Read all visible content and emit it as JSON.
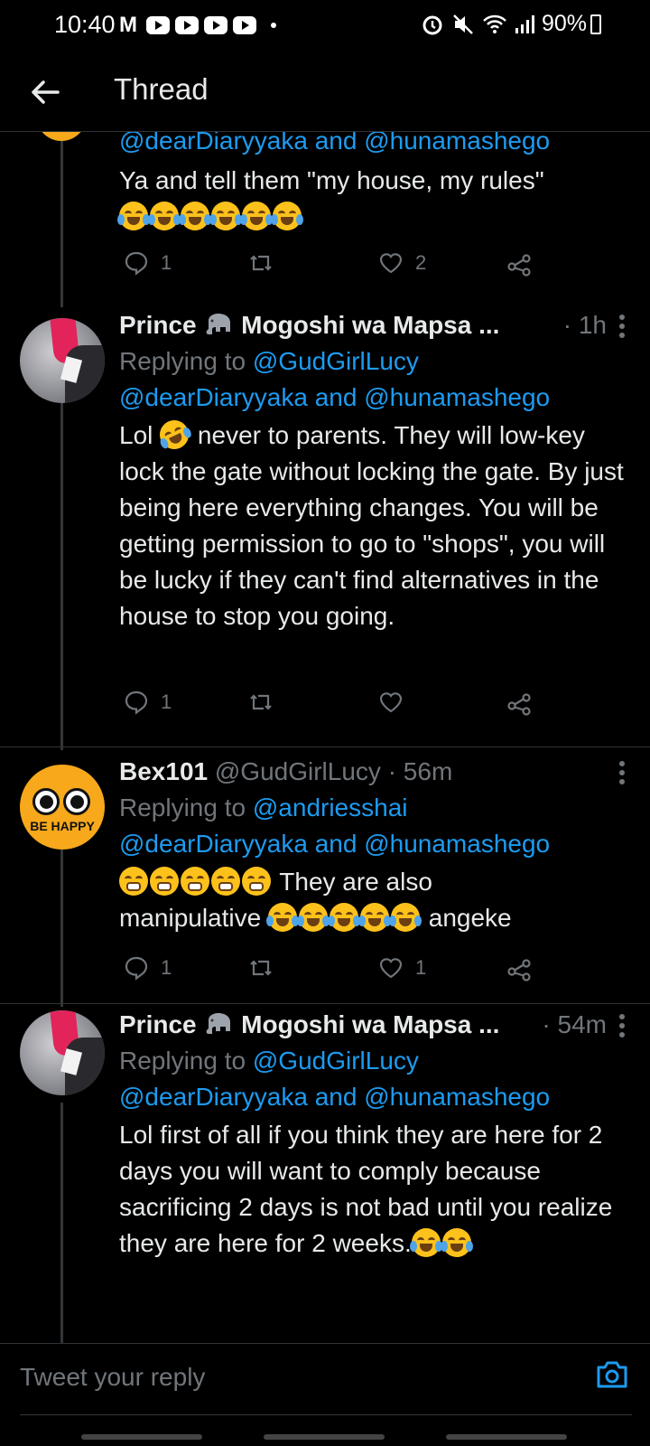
{
  "status_bar": {
    "time": "10:40",
    "mail_letter": "M",
    "battery": "90%"
  },
  "header": {
    "title": "Thread",
    "back_icon": "arrow-left-icon"
  },
  "tweets": [
    {
      "handles": "@dearDiaryyaka and @hunamashego",
      "text": "Ya and tell them \"my house, my rules\"",
      "emojis": [
        "face-with-tears-of-joy",
        "face-with-tears-of-joy",
        "face-with-tears-of-joy",
        "face-with-tears-of-joy",
        "face-with-tears-of-joy",
        "face-with-tears-of-joy"
      ],
      "actions": {
        "replies": "1",
        "retweets": "",
        "likes": "2"
      }
    },
    {
      "name": "Prince",
      "name_emoji": "elephant",
      "name2": "Mogoshi wa Mapsa ...",
      "time": "· 1h",
      "replying_prefix": "Replying to ",
      "replying_to": "@GudGirlLucy",
      "handles": "@dearDiaryyaka and @hunamashego",
      "text_before_emoji": "Lol ",
      "text_after_emoji": " never to parents. They will low-key lock the gate without locking the gate. By just being here everything changes. You will be getting permission to go to \"shops\", you will be lucky if they can't find alternatives in the house to stop you going.",
      "actions": {
        "replies": "1",
        "retweets": "",
        "likes": ""
      }
    },
    {
      "name": "Bex101",
      "handle": "@GudGirlLucy",
      "time": "· 56m",
      "avatar_text": "BE HAPPY",
      "replying_prefix": "Replying to ",
      "replying_to": "@andriesshai",
      "handles": "@dearDiaryyaka and @hunamashego",
      "text_part1": "They are also",
      "text_part2": "manipulative",
      "text_part3": "angeke",
      "actions": {
        "replies": "1",
        "retweets": "",
        "likes": "1"
      }
    },
    {
      "name": "Prince",
      "name2": "Mogoshi wa Mapsa ...",
      "time": "· 54m",
      "replying_prefix": "Replying to ",
      "replying_to": "@GudGirlLucy",
      "handles": "@dearDiaryyaka and @hunamashego",
      "text": "Lol first of all if you think they are here for 2 days you will want to comply because sacrificing 2 days is not bad until you realize they are here for 2 weeks."
    }
  ],
  "composer": {
    "placeholder": "Tweet your reply"
  },
  "colors": {
    "background": "#000000",
    "text": "#e7e9ea",
    "muted": "#71767b",
    "link": "#1d9bf0"
  }
}
